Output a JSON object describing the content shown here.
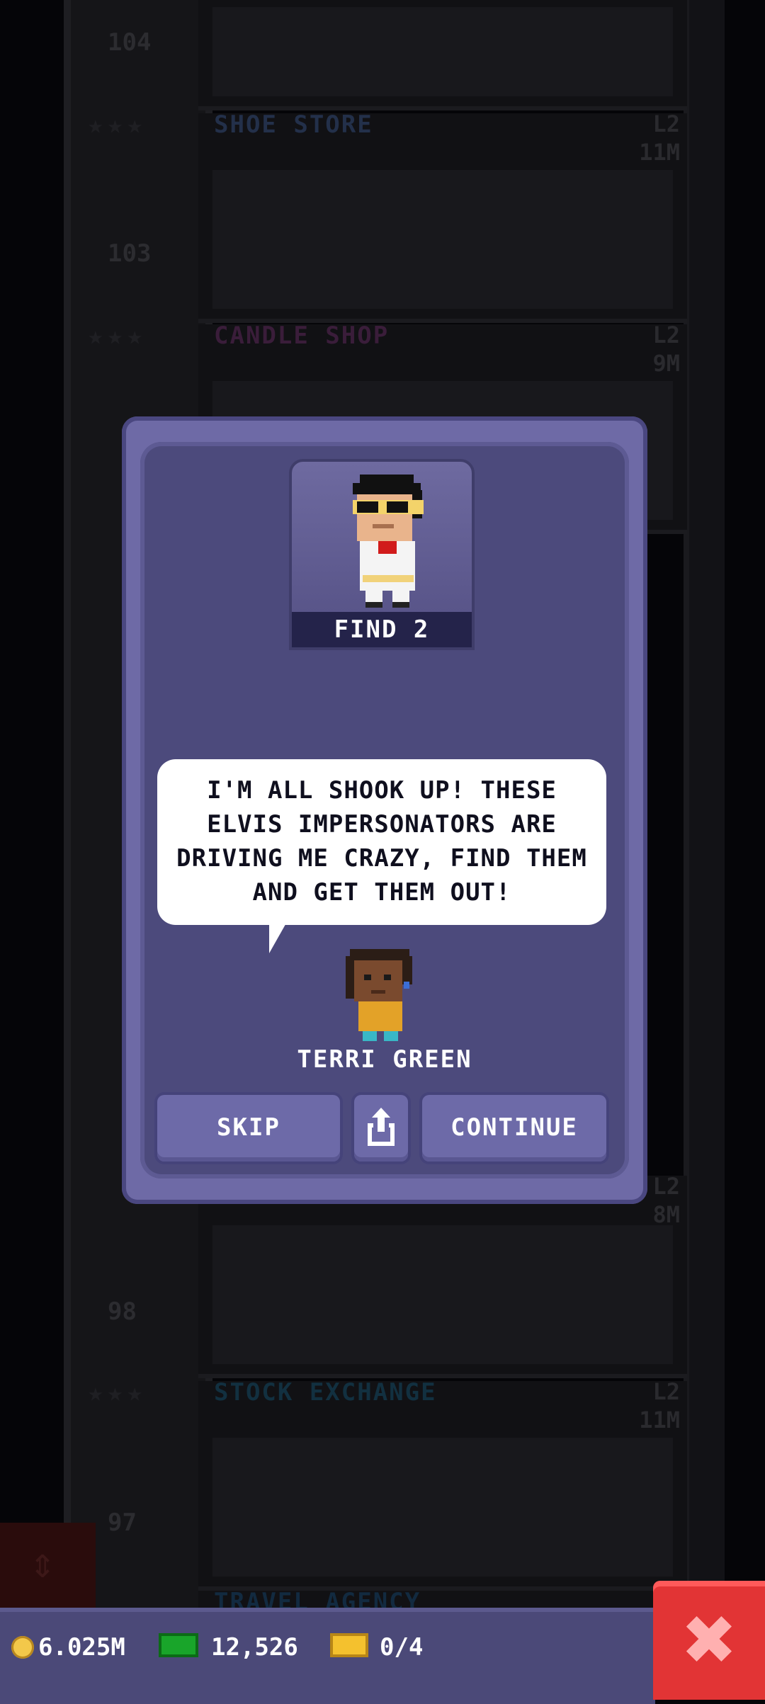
{
  "background": {
    "floors": [
      {
        "number": "104",
        "store": "",
        "level": "",
        "price": ""
      },
      {
        "number": "103",
        "store": "SHOE STORE",
        "store_color": "#23304a",
        "level": "L2",
        "price": "11M"
      },
      {
        "number": "",
        "store": "CANDLE SHOP",
        "store_color": "#3a1d3a",
        "level": "L2",
        "price": "9M"
      },
      {
        "number": "98",
        "store": "",
        "level": "L2",
        "price": "8M"
      },
      {
        "number": "97",
        "store": "STOCK EXCHANGE",
        "store_color": "#123040",
        "level": "L2",
        "price": "11M"
      },
      {
        "number": "",
        "store": "TRAVEL AGENCY",
        "store_color": "#122a40",
        "level": "",
        "price": ""
      }
    ]
  },
  "dialog": {
    "find_label": "FIND 2",
    "message": "I'M ALL SHOOK UP! THESE ELVIS IMPERSONATORS ARE DRIVING ME CRAZY, FIND THEM AND GET THEM OUT!",
    "npc_name": "TERRI GREEN",
    "skip_label": "SKIP",
    "continue_label": "CONTINUE",
    "share_icon": "share-icon"
  },
  "bottom_bar": {
    "coins": "6.025M",
    "bux": "12,526",
    "tickets": "0/4"
  },
  "colors": {
    "dialog_frame": "#6e6aa6",
    "dialog_inner": "#4c4a7c",
    "close_button": "#e23435",
    "coin": "#f3c84a",
    "bux": "#19a52a"
  }
}
